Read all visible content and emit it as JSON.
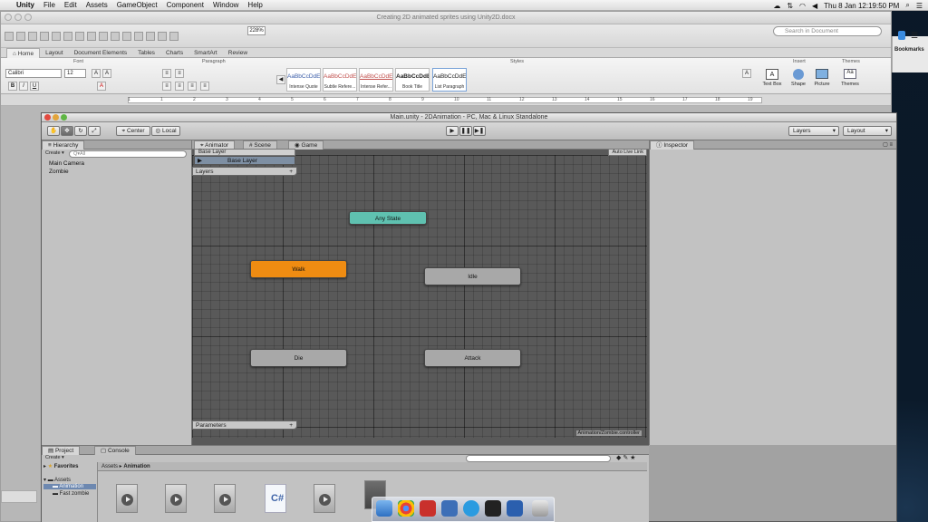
{
  "menubar": {
    "app": "Unity",
    "items": [
      "File",
      "Edit",
      "Assets",
      "GameObject",
      "Component",
      "Window",
      "Help"
    ],
    "clock": "Thu 8 Jan  12:19:50 PM"
  },
  "word": {
    "title": "Creating 2D animated sprites using Unity2D.docx",
    "search_placeholder": "Search in Document",
    "zoom": "228%",
    "tabs": [
      "Home",
      "Layout",
      "Document Elements",
      "Tables",
      "Charts",
      "SmartArt",
      "Review"
    ],
    "groups": {
      "font": "Font",
      "paragraph": "Paragraph",
      "styles": "Styles",
      "insert": "Insert",
      "themes": "Themes"
    },
    "font_name": "Calibri",
    "font_size": "12",
    "styles": [
      {
        "sample": "AaBbCcDdE",
        "name": "Intense Quote",
        "color": "#3b5da8"
      },
      {
        "sample": "AaBbCcDdEe",
        "name": "Subtle Refere...",
        "color": "#c0504d"
      },
      {
        "sample": "AaBbCcDdEe",
        "name": "Intense Refer...",
        "color": "#c0504d"
      },
      {
        "sample": "AaBbCcDdEe",
        "name": "Book Title",
        "color": "#111111"
      },
      {
        "sample": "AaBbCcDdEe",
        "name": "List Paragraph",
        "color": "#111111"
      }
    ],
    "insert_items": [
      "Text Box",
      "Shape",
      "Picture"
    ],
    "themes_label": "Themes",
    "bookmarks": "Bookmarks",
    "ruler_numbers": [
      "1",
      "1",
      "2",
      "3",
      "4",
      "5",
      "6",
      "7",
      "8",
      "9",
      "10",
      "11",
      "12",
      "13",
      "14",
      "15",
      "16",
      "17",
      "18",
      "19"
    ]
  },
  "unity": {
    "title": "Main.unity - 2DAnimation - PC, Mac & Linux Standalone",
    "pivot": "Center",
    "space": "Local",
    "layers_dropdown": "Layers",
    "layout_dropdown": "Layout",
    "hierarchy": {
      "tab": "Hierarchy",
      "create": "Create",
      "search_placeholder": "Q▾All",
      "items": [
        "Main Camera",
        "Zombie"
      ]
    },
    "animator": {
      "tabs": [
        "Animator",
        "Scene",
        "Game"
      ],
      "breadcrumb": "Base Layer",
      "auto_live_link": "Auto Live Link",
      "layers_label": "Layers",
      "base_layer": "Base Layer",
      "parameters_label": "Parameters",
      "controller_path": "Animation/Zombie.controller",
      "states": [
        {
          "name": "Any State",
          "color": "#5fc1b0"
        },
        {
          "name": "Walk",
          "color": "#ef8c12"
        },
        {
          "name": "Idle",
          "color": "#a8a8a8"
        },
        {
          "name": "Die",
          "color": "#a8a8a8"
        },
        {
          "name": "Attack",
          "color": "#a8a8a8"
        }
      ]
    },
    "inspector": {
      "tab": "Inspector"
    },
    "project": {
      "tabs": [
        "Project",
        "Console"
      ],
      "create": "Create",
      "favorites": "Favorites",
      "folders": [
        "Assets",
        "Animation",
        "Fast zombie"
      ],
      "breadcrumb": [
        "Assets",
        "Animation"
      ],
      "script_glyph": "C#"
    }
  }
}
